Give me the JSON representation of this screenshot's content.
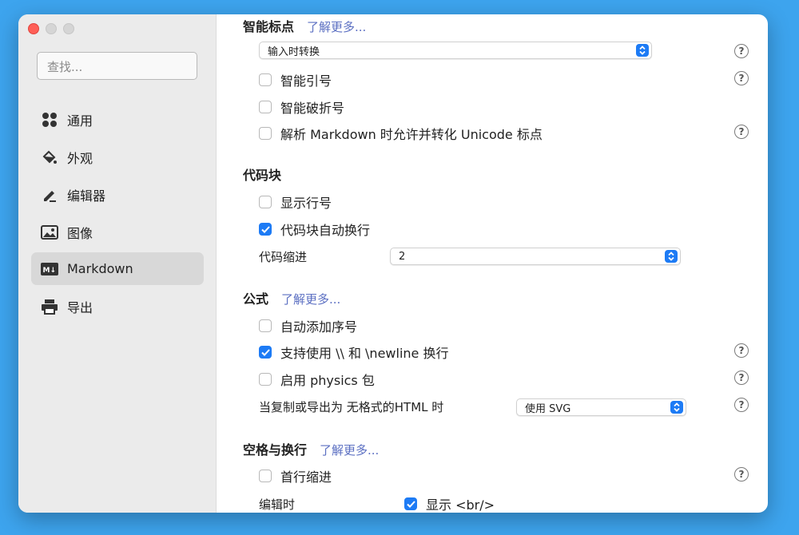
{
  "search": {
    "placeholder": "查找..."
  },
  "sidebar": {
    "items": [
      {
        "label": "通用",
        "icon": "grid-icon"
      },
      {
        "label": "外观",
        "icon": "paint-bucket-icon"
      },
      {
        "label": "编辑器",
        "icon": "pencil-icon"
      },
      {
        "label": "图像",
        "icon": "image-icon"
      },
      {
        "label": "Markdown",
        "icon": "markdown-icon",
        "active": true
      },
      {
        "label": "导出",
        "icon": "printer-icon"
      }
    ]
  },
  "smart_punct": {
    "title": "智能标点",
    "learn_more": "了解更多...",
    "mode_value": "输入时转换",
    "smart_quotes": "智能引号",
    "smart_dashes": "智能破折号",
    "unicode_punct": "解析 Markdown 时允许并转化 Unicode 标点"
  },
  "code_block": {
    "title": "代码块",
    "line_numbers": "显示行号",
    "auto_wrap": "代码块自动换行",
    "indent_label": "代码缩进",
    "indent_value": "2"
  },
  "math": {
    "title": "公式",
    "learn_more": "了解更多...",
    "auto_number": "自动添加序号",
    "newline_support": "支持使用 \\\\ 和 \\newline 换行",
    "physics": "启用 physics 包",
    "export_label": "当复制或导出为 无格式的HTML 时",
    "export_value": "使用 SVG"
  },
  "whitespace": {
    "title": "空格与换行",
    "learn_more": "了解更多...",
    "first_line_indent": "首行缩进",
    "edit_label": "编辑时",
    "show_br": "显示 <br/>"
  },
  "help_glyph": "?",
  "colors": {
    "accent": "#1d7bf5",
    "link": "#5b6fc2",
    "desktop": "#3da4ee"
  }
}
